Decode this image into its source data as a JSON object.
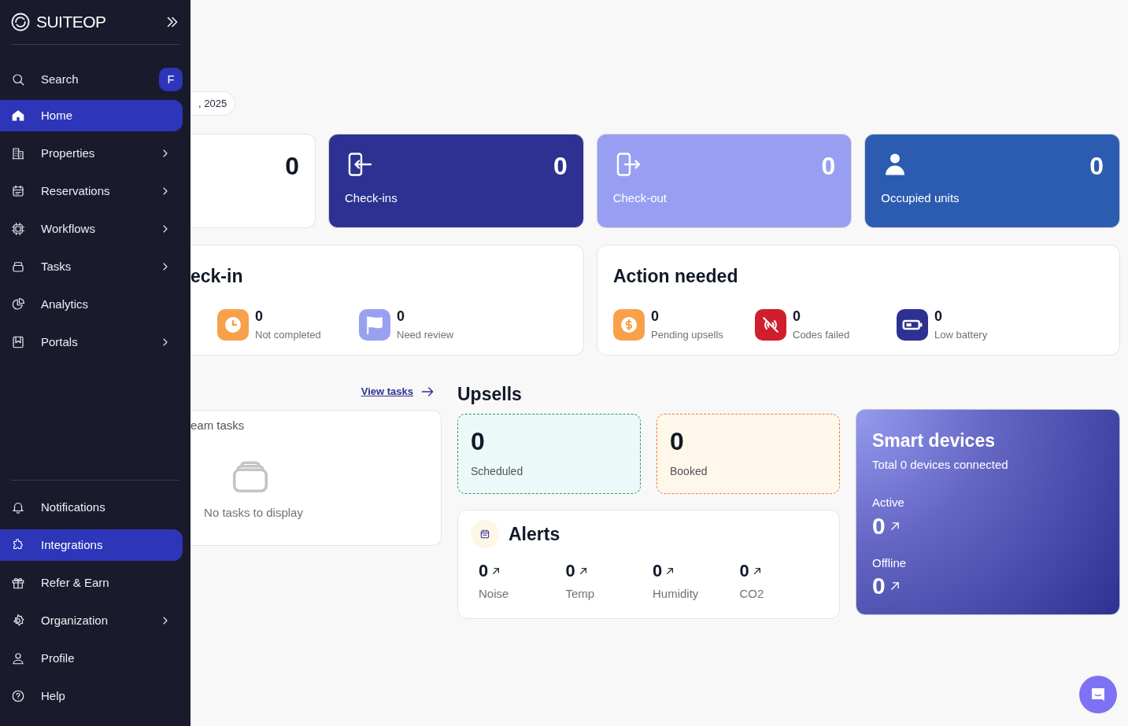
{
  "sidebar": {
    "logo": "SUITEOP",
    "search": {
      "label": "Search",
      "badge": "F"
    },
    "items": [
      {
        "label": "Home",
        "selected": true,
        "expandable": false
      },
      {
        "label": "Properties",
        "selected": false,
        "expandable": true
      },
      {
        "label": "Reservations",
        "selected": false,
        "expandable": true
      },
      {
        "label": "Workflows",
        "selected": false,
        "expandable": true
      },
      {
        "label": "Tasks",
        "selected": false,
        "expandable": true
      },
      {
        "label": "Analytics",
        "selected": false,
        "expandable": false
      },
      {
        "label": "Portals",
        "selected": false,
        "expandable": true
      }
    ],
    "bottom_items": [
      {
        "label": "Notifications",
        "selected": false,
        "expandable": false
      },
      {
        "label": "Integrations",
        "selected": true,
        "expandable": false
      },
      {
        "label": "Refer & Earn",
        "selected": false,
        "expandable": false
      },
      {
        "label": "Organization",
        "selected": false,
        "expandable": true
      },
      {
        "label": "Profile",
        "selected": false,
        "expandable": false
      },
      {
        "label": "Help",
        "selected": false,
        "expandable": false
      }
    ]
  },
  "date_pill": ", 2025",
  "stat_cards": [
    {
      "kind": "plain",
      "value": "0",
      "color": "#ffffff"
    },
    {
      "kind": "filled",
      "value": "0",
      "label": "Check-ins",
      "color": "#2c3192"
    },
    {
      "kind": "filled",
      "value": "0",
      "label": "Check-out",
      "color": "#989ff2"
    },
    {
      "kind": "filled",
      "value": "0",
      "label": "Occupied units",
      "color": "#2b5cb0"
    }
  ],
  "checkin_panel": {
    "title": "eck-in",
    "stats": [
      {
        "value": "0",
        "label": "Not completed",
        "color": "#f9a04a"
      },
      {
        "value": "0",
        "label": "Need review",
        "color": "#9aa0f0"
      }
    ]
  },
  "action_needed": {
    "title": "Action needed",
    "stats": [
      {
        "value": "0",
        "label": "Pending upsells",
        "color": "#f9a04a"
      },
      {
        "value": "0",
        "label": "Codes failed",
        "color": "#cf1f2e"
      },
      {
        "value": "0",
        "label": "Low battery",
        "color": "#2c3192"
      }
    ]
  },
  "tasks": {
    "link": "View tasks",
    "subtitle": "eam tasks",
    "empty": "No tasks to display"
  },
  "upsells": {
    "title": "Upsells",
    "cards": [
      {
        "kind": "scheduled",
        "value": "0",
        "label": "Scheduled"
      },
      {
        "kind": "booked",
        "value": "0",
        "label": "Booked"
      }
    ]
  },
  "alerts": {
    "title": "Alerts",
    "items": [
      {
        "value": "0",
        "label": "Noise"
      },
      {
        "value": "0",
        "label": "Temp"
      },
      {
        "value": "0",
        "label": "Humidity"
      },
      {
        "value": "0",
        "label": "CO2"
      }
    ]
  },
  "smart_devices": {
    "title": "Smart devices",
    "subtitle": "Total 0 devices connected",
    "groups": [
      {
        "label": "Active",
        "value": "0"
      },
      {
        "label": "Offline",
        "value": "0"
      }
    ]
  }
}
